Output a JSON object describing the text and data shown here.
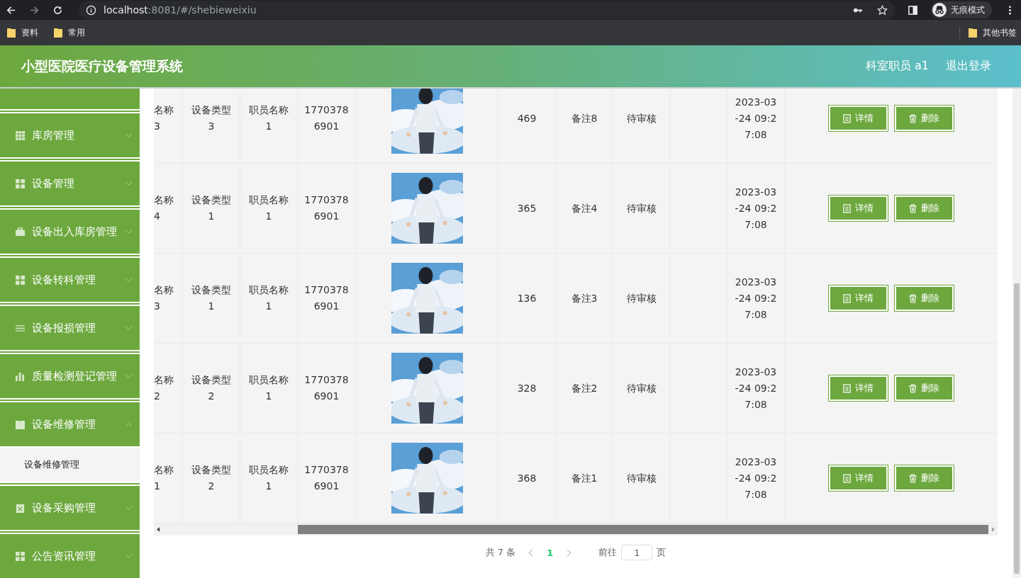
{
  "browser": {
    "url_host": "localhost",
    "url_path": ":8081/#/shebieweixiu",
    "forward_disabled": true,
    "profile": "无痕模式",
    "bookmarks": [
      {
        "label": "资料"
      },
      {
        "label": "常用"
      }
    ],
    "other_bookmarks": "其他书签"
  },
  "header": {
    "title": "小型医院医疗设备管理系统",
    "user": "科室职员 a1",
    "logout": "退出登录"
  },
  "sidebar": {
    "items": [
      {
        "label": "库房管理",
        "expanded": false
      },
      {
        "label": "设备管理",
        "expanded": false
      },
      {
        "label": "设备出入库房管理",
        "expanded": false
      },
      {
        "label": "设备转科管理",
        "expanded": false
      },
      {
        "label": "设备报损管理",
        "expanded": false
      },
      {
        "label": "质量检测登记管理",
        "expanded": false
      },
      {
        "label": "设备维修管理",
        "expanded": true,
        "children": [
          {
            "label": "设备维修管理",
            "selected": true
          }
        ]
      },
      {
        "label": "设备采购管理",
        "expanded": false
      },
      {
        "label": "公告资讯管理",
        "expanded": false
      }
    ]
  },
  "table": {
    "rows": [
      {
        "name": "名称\n3",
        "type": "设备类型\n3",
        "staff": "职员名称\n1",
        "phone": "1770378\n6901",
        "number": "469",
        "note": "备注8",
        "status": "待审核",
        "time": "2023-03\n-24 09:2\n7:08",
        "actions": [
          "详情",
          "删除"
        ]
      },
      {
        "name": "名称\n4",
        "type": "设备类型\n1",
        "staff": "职员名称\n1",
        "phone": "1770378\n6901",
        "number": "365",
        "note": "备注4",
        "status": "待审核",
        "time": "2023-03\n-24 09:2\n7:08",
        "actions": [
          "详情",
          "删除"
        ]
      },
      {
        "name": "名称\n3",
        "type": "设备类型\n1",
        "staff": "职员名称\n1",
        "phone": "1770378\n6901",
        "number": "136",
        "note": "备注3",
        "status": "待审核",
        "time": "2023-03\n-24 09:2\n7:08",
        "actions": [
          "详情",
          "删除"
        ]
      },
      {
        "name": "名称\n2",
        "type": "设备类型\n2",
        "staff": "职员名称\n1",
        "phone": "1770378\n6901",
        "number": "328",
        "note": "备注2",
        "status": "待审核",
        "time": "2023-03\n-24 09:2\n7:08",
        "actions": [
          "详情",
          "删除"
        ]
      },
      {
        "name": "名称\n1",
        "type": "设备类型\n2",
        "staff": "职员名称\n1",
        "phone": "1770378\n6901",
        "number": "368",
        "note": "备注1",
        "status": "待审核",
        "time": "2023-03\n-24 09:2\n7:08",
        "actions": [
          "详情",
          "删除"
        ]
      }
    ]
  },
  "pagination": {
    "total": "共 7 条",
    "pages": [
      {
        "label": "1",
        "selected": true
      }
    ],
    "goto": "前往",
    "page_value": "1",
    "page_unit": "页"
  }
}
